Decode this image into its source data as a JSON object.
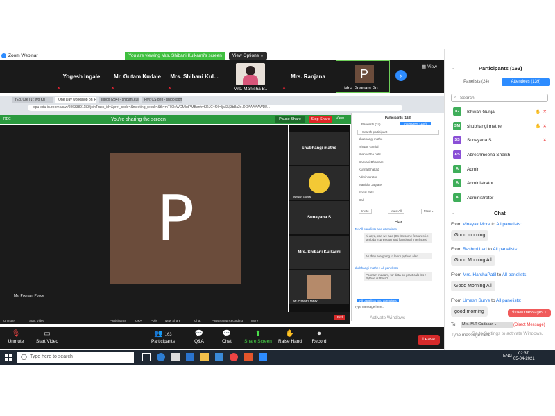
{
  "window": {
    "title": "Zoom Webinar",
    "controls": [
      "—",
      "❐",
      "✕"
    ]
  },
  "banner": {
    "viewing": "You are viewing Mrs. Shibani Kulkarni's screen",
    "view_options": "View Options ⌄"
  },
  "gallery": {
    "tiles": [
      "Yogesh Ingale",
      "Mr. Gutam Kudale",
      "Mrs. Shibani Kul...",
      "Mrs. Manisha B...",
      "Mrs. Ranjana",
      "Mrs. Poonam Po..."
    ],
    "poonam_initial": "P",
    "view_label": "View"
  },
  "browser": {
    "tabs": [
      "rEd. Cre (u): wo Kri",
      "One Day workshop on 'Pyth",
      "Inbox (234) - shibani.kulkarni@",
      "Fwl: CS.gen - shibo@gmail.com"
    ],
    "url": "dpu-edu-in.zoom.us/w/98633891183/joinTrack_id=&pref_code=&meeting_result=&tk=mTk9ktWGMkdPMBanhvKRJC4f9ll=ljaSNj3b8a2o.DOAAAAAWDlf..."
  },
  "sharing": {
    "text": "You're sharing the screen",
    "pause": "Pause Share",
    "stop": "Stop Share",
    "view": "View",
    "rec": "REC"
  },
  "inner": {
    "p_initial": "P",
    "name_label": "Ms. Poonam Ponde",
    "tiles": [
      "shubhangi mathe",
      "",
      "Sunayana S",
      "Mrs. Shibani Kulkarni",
      ""
    ],
    "tile_captions": [
      "",
      "Ishwari Gunjal",
      "",
      "",
      "Mr. Prashant Malav"
    ],
    "panel_title": "Participants (163)",
    "panel_tabs": [
      "Panelists (24)",
      "Attendees (139)"
    ],
    "panel_search": "Search participant",
    "panel_people": [
      "shubhangi mathe",
      "Ishwari Gunjal",
      "shanuchha patil",
      "Bhavani Bhamare",
      "Kunna Bhakad",
      "Administrator",
      "Manisha Jagtate",
      "Sonal Patil",
      "Dall"
    ],
    "panel_buttons": [
      "Invite",
      "Mute All",
      "More ▸"
    ],
    "chat_title": "Chat",
    "chat_from1": "To: All panelists and attendees",
    "chat_msg1": "hi Jaya, can we add (Ok it's some features i.e lambda expression and functional interfaces)",
    "chat_msg2": "As they are going to learn python also",
    "chat_from2": "shubhangi mathe : All panelists",
    "chat_msg3": "Poonam madam, for data on practicals it s r Python is there?",
    "chat_to": "All panelists and attendees",
    "chat_placeholder": "Type message here...",
    "toolbar": [
      "Unmute",
      "Start Video",
      "Participants",
      "Q&A",
      "Polls",
      "New Share",
      "Chat",
      "Pause/Stop Recording",
      "More",
      "End"
    ]
  },
  "toolbar": {
    "unmute": "Unmute",
    "start_video": "Start Video",
    "participants": "Participants",
    "participants_count": "163",
    "qa": "Q&A",
    "chat": "Chat",
    "share": "Share Screen",
    "raise": "Raise Hand",
    "record": "Record",
    "leave": "Leave"
  },
  "participants_panel": {
    "title": "Participants (163)",
    "tab_panelists": "Panelists (24)",
    "tab_attendees": "Attendees (139)",
    "search_placeholder": "Search",
    "people": [
      {
        "initials": "IG",
        "name": "Ishwari Gunjal",
        "color": "#3fae5a"
      },
      {
        "initials": "SM",
        "name": "shubhangi mathe",
        "color": "#3fae5a"
      },
      {
        "initials": "SS",
        "name": "Sunayana S",
        "color": "#8a4fd6"
      },
      {
        "initials": "AS",
        "name": "Abreshmeena Shaikh",
        "color": "#8a4fd6"
      },
      {
        "initials": "A",
        "name": "Admin",
        "color": "#3fae5a"
      },
      {
        "initials": "A",
        "name": "Administrator",
        "color": "#3fae5a"
      },
      {
        "initials": "A",
        "name": "Administrator",
        "color": "#3fae5a"
      }
    ]
  },
  "chat_panel": {
    "title": "Chat",
    "messages": [
      {
        "from": "Vinayak More",
        "to": "All panelists:",
        "text": "Good morning"
      },
      {
        "from": "Rashmi Lad",
        "to": "All panelists:",
        "text": "Good Morning All"
      },
      {
        "from": "Mrs. HarshaPatil",
        "to": "All panelists:",
        "text": "Good Morning All"
      },
      {
        "from": "Umesh Surve",
        "to": "All panelists:",
        "text": "good morning"
      }
    ],
    "new_messages": "9 new messages ↓",
    "to_label": "To:",
    "to_value": "Mrs. M.T Gadakar ⌄",
    "direct": "(Direct Message)",
    "input_placeholder": "Type message here...",
    "activate": "Activate Windows",
    "activate_sub": "Go to Settings to activate Windows."
  },
  "taskbar": {
    "search_placeholder": "Type here to search",
    "time": "02:37",
    "date": "05-04-2021",
    "lang": "ENG"
  }
}
